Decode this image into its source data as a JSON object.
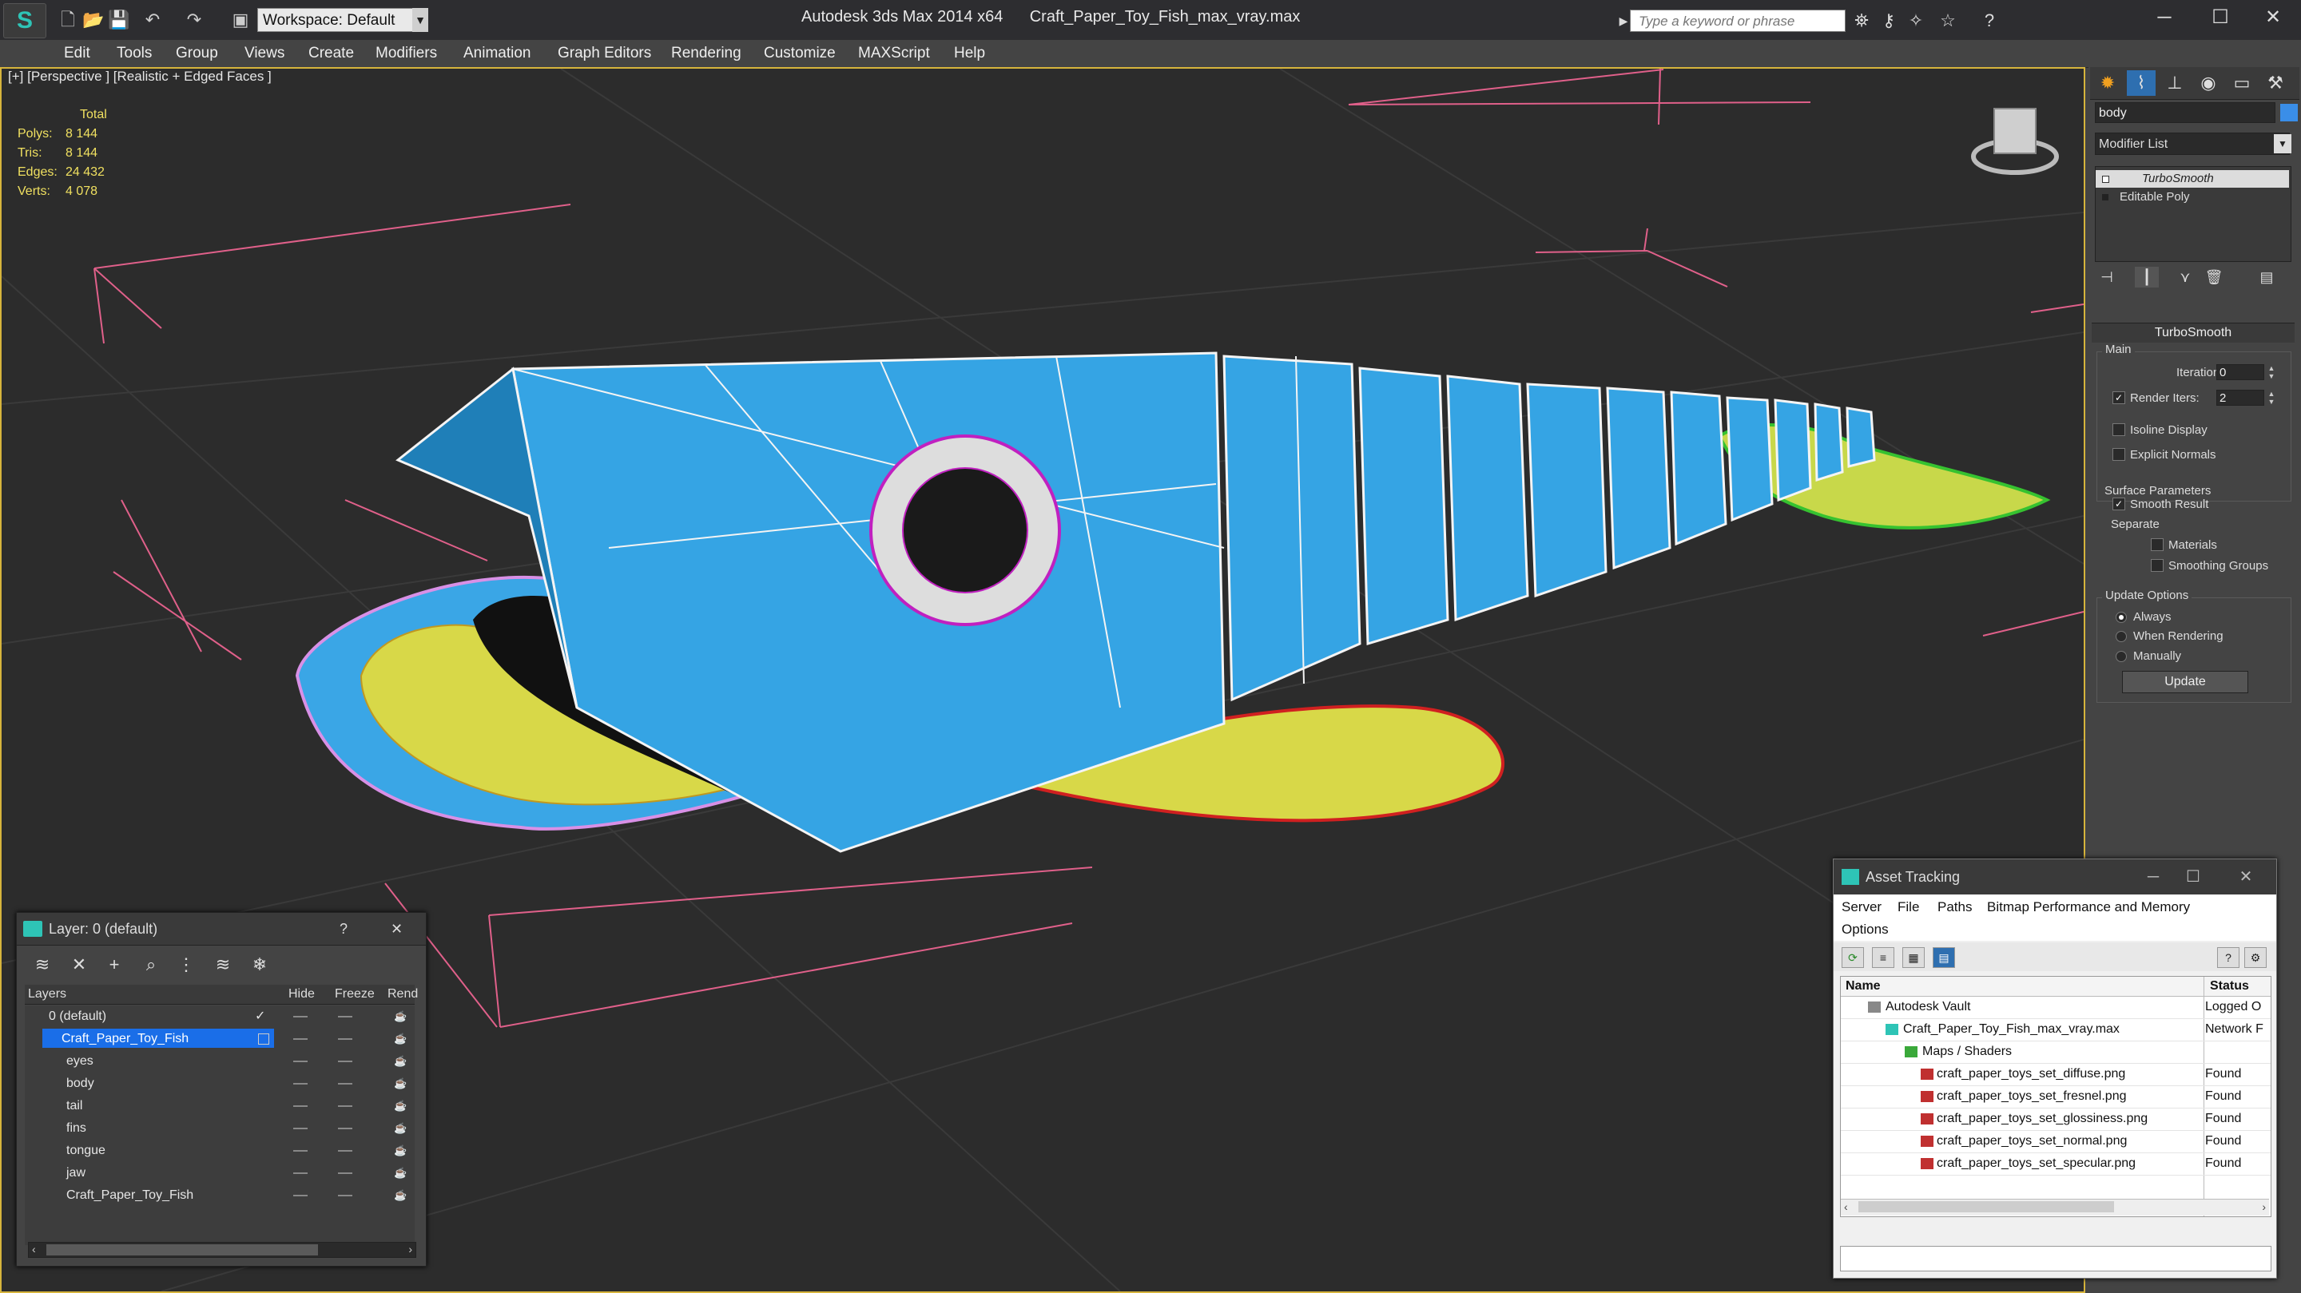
{
  "titlebar": {
    "workspace_label": "Workspace: Default",
    "app_name": "Autodesk 3ds Max  2014 x64",
    "file_name": "Craft_Paper_Toy_Fish_max_vray.max",
    "search_placeholder": "Type a keyword or phrase"
  },
  "menu": [
    "Edit",
    "Tools",
    "Group",
    "Views",
    "Create",
    "Modifiers",
    "Animation",
    "Graph Editors",
    "Rendering",
    "Customize",
    "MAXScript",
    "Help"
  ],
  "viewport": {
    "label": "[+] [Perspective ] [Realistic + Edged Faces ]",
    "stats": {
      "header": "Total",
      "polys_label": "Polys:",
      "polys": "8 144",
      "tris_label": "Tris:",
      "tris": "8 144",
      "edges_label": "Edges:",
      "edges": "24 432",
      "verts_label": "Verts:",
      "verts": "4 078"
    }
  },
  "command_panel": {
    "object_name": "body",
    "object_color": "#3a8ee8",
    "modifier_list": "Modifier List",
    "stack": [
      "TurboSmooth",
      "Editable Poly"
    ],
    "rollout_title": "TurboSmooth",
    "main_group": "Main",
    "iterations_label": "Iterations:",
    "iterations_value": "0",
    "render_iters_label": "Render Iters:",
    "render_iters_value": "2",
    "isoline_label": "Isoline Display",
    "explicit_label": "Explicit Normals",
    "surface_group": "Surface Parameters",
    "smooth_result_label": "Smooth Result",
    "separate_label": "Separate",
    "materials_label": "Materials",
    "smoothing_groups_label": "Smoothing Groups",
    "update_group": "Update Options",
    "always_label": "Always",
    "when_rendering_label": "When Rendering",
    "manually_label": "Manually",
    "update_button": "Update"
  },
  "layer_window": {
    "title": "Layer: 0 (default)",
    "help": "?",
    "close": "✕",
    "columns": [
      "Layers",
      "Hide",
      "Freeze",
      "Rend"
    ],
    "rows": [
      "0 (default)",
      "Craft_Paper_Toy_Fish",
      "eyes",
      "body",
      "tail",
      "fins",
      "tongue",
      "jaw",
      "Craft_Paper_Toy_Fish"
    ]
  },
  "asset_window": {
    "title": "Asset Tracking",
    "menu": [
      "Server",
      "File",
      "Paths",
      "Bitmap Performance and Memory",
      "Options"
    ],
    "columns": [
      "Name",
      "Status"
    ],
    "rows": [
      {
        "name": "Autodesk Vault",
        "status": "Logged O"
      },
      {
        "name": "Craft_Paper_Toy_Fish_max_vray.max",
        "status": "Network F"
      },
      {
        "name": "Maps / Shaders",
        "status": ""
      },
      {
        "name": "craft_paper_toys_set_diffuse.png",
        "status": "Found"
      },
      {
        "name": "craft_paper_toys_set_fresnel.png",
        "status": "Found"
      },
      {
        "name": "craft_paper_toys_set_glossiness.png",
        "status": "Found"
      },
      {
        "name": "craft_paper_toys_set_normal.png",
        "status": "Found"
      },
      {
        "name": "craft_paper_toys_set_specular.png",
        "status": "Found"
      }
    ]
  }
}
